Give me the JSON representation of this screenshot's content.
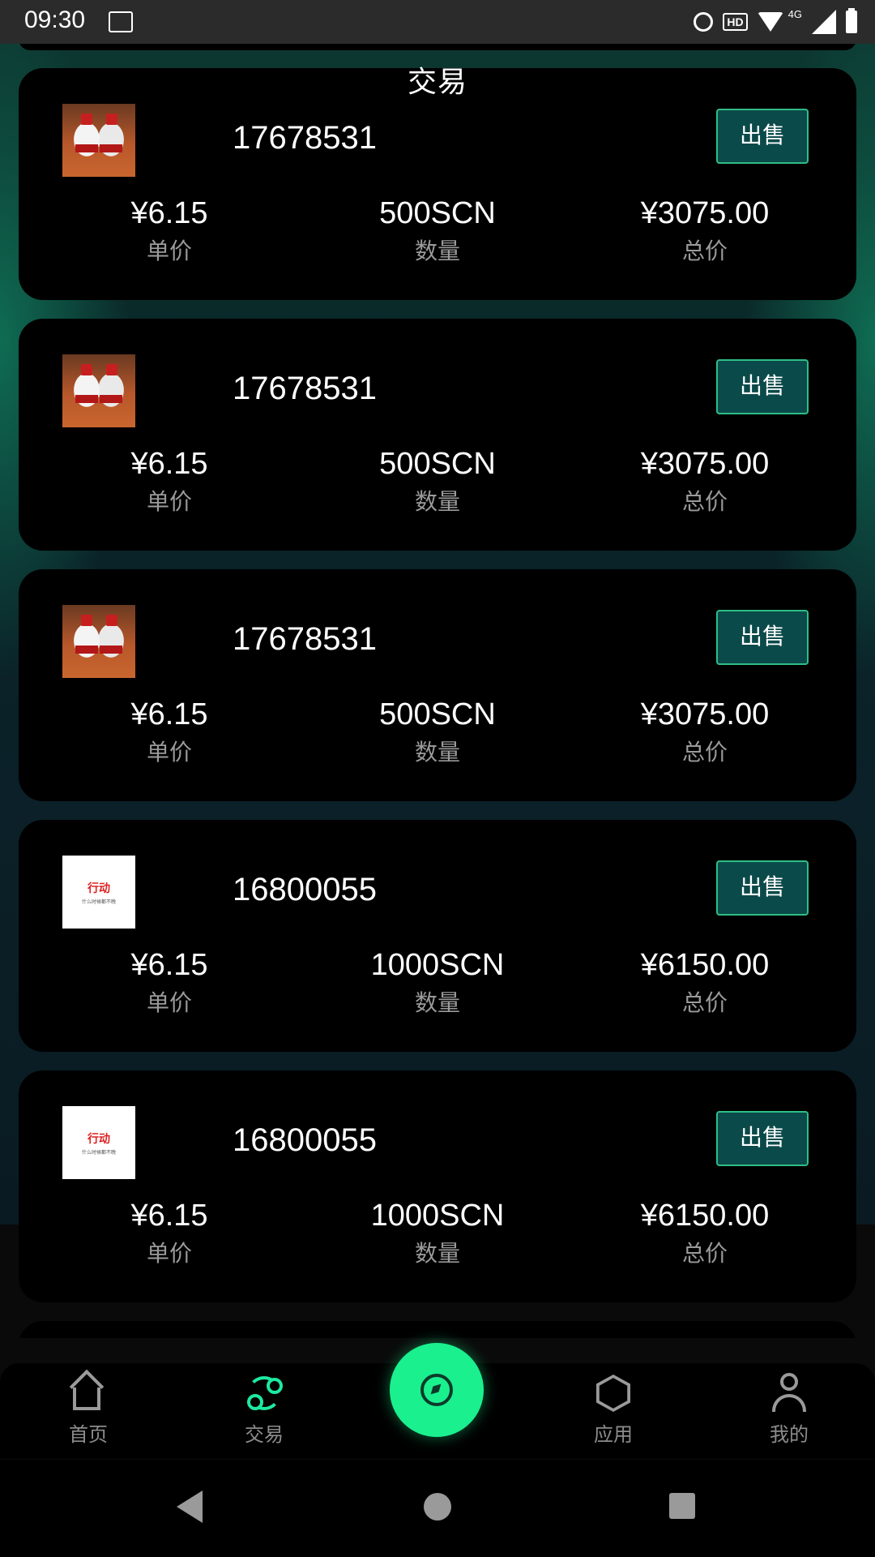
{
  "status_bar": {
    "time": "09:30",
    "network": "4G"
  },
  "header": {
    "title": "交易"
  },
  "cards": [
    {
      "id": "17678531",
      "thumb": "liquor-bottles",
      "thumb_text": "",
      "thumb_sub": "",
      "sell": "出售",
      "price": "¥6.15",
      "price_label": "单价",
      "qty": "500SCN",
      "qty_label": "数量",
      "total": "¥3075.00",
      "total_label": "总价"
    },
    {
      "id": "17678531",
      "thumb": "liquor-bottles",
      "thumb_text": "",
      "thumb_sub": "",
      "sell": "出售",
      "price": "¥6.15",
      "price_label": "单价",
      "qty": "500SCN",
      "qty_label": "数量",
      "total": "¥3075.00",
      "total_label": "总价"
    },
    {
      "id": "17678531",
      "thumb": "liquor-bottles",
      "thumb_text": "",
      "thumb_sub": "",
      "sell": "出售",
      "price": "¥6.15",
      "price_label": "单价",
      "qty": "500SCN",
      "qty_label": "数量",
      "total": "¥3075.00",
      "total_label": "总价"
    },
    {
      "id": "16800055",
      "thumb": "text-logo",
      "thumb_text": "行动",
      "thumb_sub": "什么时候都不晚",
      "sell": "出售",
      "price": "¥6.15",
      "price_label": "单价",
      "qty": "1000SCN",
      "qty_label": "数量",
      "total": "¥6150.00",
      "total_label": "总价"
    },
    {
      "id": "16800055",
      "thumb": "text-logo",
      "thumb_text": "行动",
      "thumb_sub": "什么时候都不晚",
      "sell": "出售",
      "price": "¥6.15",
      "price_label": "单价",
      "qty": "1000SCN",
      "qty_label": "数量",
      "total": "¥6150.00",
      "total_label": "总价"
    }
  ],
  "tabbar": {
    "home": "首页",
    "trade": "交易",
    "apps": "应用",
    "mine": "我的",
    "active": "trade",
    "accent_color": "#1af08e"
  }
}
